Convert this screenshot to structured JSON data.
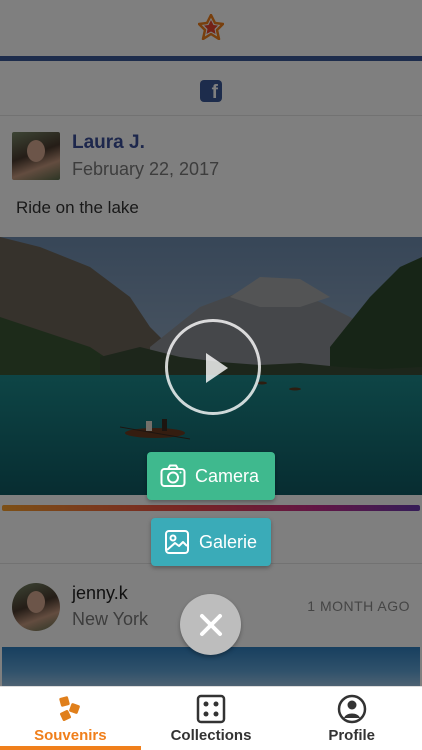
{
  "feed": {
    "post1": {
      "source": "facebook",
      "author": "Laura J.",
      "date": "February 22, 2017",
      "caption": "Ride on the lake"
    },
    "post2": {
      "source": "instagram",
      "author": "jenny.k",
      "location": "New York",
      "time_ago": "1 MONTH AGO"
    }
  },
  "actions": {
    "camera_label": "Camera",
    "galerie_label": "Galerie"
  },
  "tabs": [
    {
      "label": "Souvenirs",
      "icon": "souvenirs-icon",
      "active": true
    },
    {
      "label": "Collections",
      "icon": "collections-icon",
      "active": false
    },
    {
      "label": "Profile",
      "icon": "profile-icon",
      "active": false
    }
  ],
  "colors": {
    "accent": "#f07f1b",
    "facebook": "#3b5998",
    "camera_button": "#3fb98e",
    "galerie_button": "#3aabb8"
  }
}
